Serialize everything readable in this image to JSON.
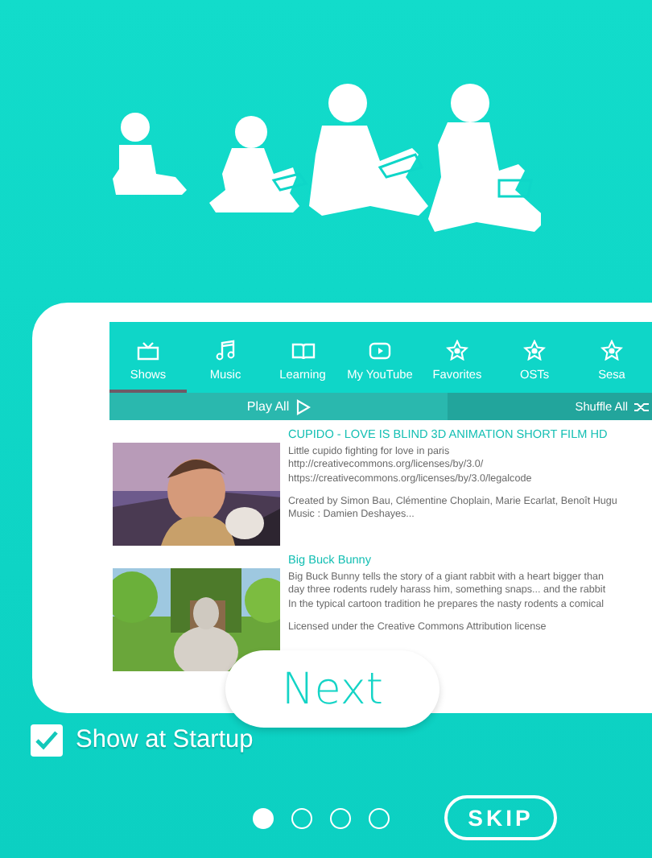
{
  "tabs": [
    {
      "label": "Shows",
      "selected": true
    },
    {
      "label": "Music",
      "selected": false
    },
    {
      "label": "Learning",
      "selected": false
    },
    {
      "label": "My YouTube",
      "selected": false
    },
    {
      "label": "Favorites",
      "selected": false
    },
    {
      "label": "OSTs",
      "selected": false
    },
    {
      "label": "Sesa",
      "selected": false
    }
  ],
  "play_all": "Play All",
  "shuffle_all": "Shuffle All",
  "videos": [
    {
      "title": "CUPIDO - LOVE IS BLIND 3D ANIMATION SHORT FILM HD",
      "paragraphs": [
        [
          "Little cupido fighting for love in paris",
          "http://creativecommons.org/licenses/by/3.0/",
          "https://creativecommons.org/licenses/by/3.0/legalcode"
        ],
        [
          "Created by Simon Bau, Clémentine Choplain, Marie Ecarlat, Benoît Hugu",
          "Music : Damien Deshayes..."
        ]
      ]
    },
    {
      "title": "Big Buck Bunny",
      "paragraphs": [
        [
          "Big Buck Bunny tells the story of a giant rabbit with a heart bigger than",
          "day three rodents rudely harass him, something snaps... and the rabbit",
          "In the typical cartoon tradition he prepares the nasty rodents a comical"
        ],
        [
          "Licensed under the Creative Commons Attribution license"
        ]
      ]
    }
  ],
  "next": "Next",
  "show_at_startup": {
    "label": "Show at Startup",
    "checked": true
  },
  "dots": [
    {
      "selected": true
    },
    {
      "selected": false
    },
    {
      "selected": false
    },
    {
      "selected": false
    }
  ],
  "skip": "SKIP"
}
